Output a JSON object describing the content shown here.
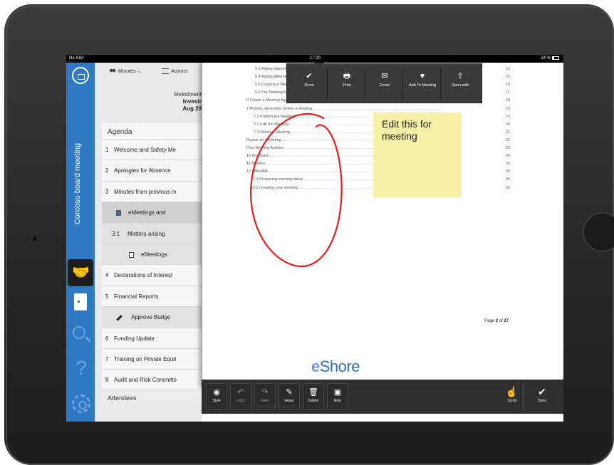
{
  "status_bar": {
    "carrier": "No SIM",
    "time": "17:20",
    "battery": "24 %"
  },
  "rail": {
    "title": "Contoso board meeting"
  },
  "panel": {
    "toolbar": {
      "minutes": "Minutes",
      "actions": "Actions"
    },
    "header": {
      "line1": "Investment",
      "line2": "Investr",
      "line3": "Aug 20"
    },
    "agenda_title": "Agenda",
    "agenda": [
      {
        "num": "1",
        "label": "Welcome and Safety Me"
      },
      {
        "num": "2",
        "label": "Apologies for Absence"
      },
      {
        "num": "3",
        "label": "Minutes from previous m"
      },
      {
        "num": "",
        "label": "eMeetings and"
      },
      {
        "num": "3.1",
        "label": "Matters arising"
      },
      {
        "num": "",
        "label": "eMeetings"
      },
      {
        "num": "4",
        "label": "Declarations of Interest"
      },
      {
        "num": "5",
        "label": "Financial Reports"
      },
      {
        "num": "",
        "label": "Approve Budge"
      },
      {
        "num": "6",
        "label": "Funding Update"
      },
      {
        "num": "7",
        "label": "Training on Private Equit"
      },
      {
        "num": "8",
        "label": "Audit and Risk Committe"
      }
    ],
    "attendees": "Attendees"
  },
  "document": {
    "toc": [
      {
        "text": "5.3  Adding Agenda Items",
        "page": "13"
      },
      {
        "text": "5.4  Adding Attendees",
        "page": "15"
      },
      {
        "text": "5.5  Copying a Meeting",
        "page": "16"
      },
      {
        "text": "5.6  Pre Meeting Actions",
        "page": "17"
      },
      {
        "text": "6  Create a Meeting Agenda",
        "page": "18"
      },
      {
        "text": "7  Publish, Amend/or Delete a Meeting",
        "page": "19"
      },
      {
        "text": "7.1  Publish the Meeting",
        "page": "19"
      },
      {
        "text": "7.2  Edit the Meeting",
        "page": "20"
      },
      {
        "text": "7.3  Delete a Meeting",
        "page": "21"
      },
      {
        "text": "Revive an eMeeting",
        "page": "22"
      },
      {
        "text": "Post Meeting Actions",
        "page": "23"
      },
      {
        "text": "10  Feedback",
        "page": "24"
      },
      {
        "text": "11  Minutes",
        "page": "24"
      },
      {
        "text": "12  eMeetMe",
        "page": "25"
      },
      {
        "text": "12.1  Proposing meeting dates",
        "page": "25"
      },
      {
        "text": "12.2  Creating your meeting",
        "page": "26"
      }
    ],
    "footer_prefix": "Page ",
    "footer_current": "2",
    "footer_mid": " of ",
    "footer_total": "27",
    "sticky_note": "Edit this for meeting",
    "logo_e": "e",
    "logo_text": "Shore",
    "ghost_text": "Technical Support"
  },
  "popup": {
    "buttons": [
      {
        "icon": "checkmark-icon",
        "glyph": "✔",
        "label": "Done"
      },
      {
        "icon": "print-icon",
        "glyph": "🖶",
        "label": "Print"
      },
      {
        "icon": "envelope-icon",
        "glyph": "✉",
        "label": "Email"
      },
      {
        "icon": "heart-icon",
        "glyph": "♥",
        "label": "Add To Meeting"
      },
      {
        "icon": "share-icon",
        "glyph": "⇧",
        "label": "Open with"
      }
    ]
  },
  "bottom_bar": {
    "tools": [
      {
        "icon": "style-icon",
        "glyph": "◉",
        "label": "Style"
      },
      {
        "icon": "undo-icon",
        "glyph": "↶",
        "label": "Undo"
      },
      {
        "icon": "redo-icon",
        "glyph": "↷",
        "label": "Redo"
      },
      {
        "icon": "eraser-icon",
        "glyph": "✎",
        "label": "Erase"
      },
      {
        "icon": "trash-icon",
        "glyph": "🗑",
        "label": "Delete"
      },
      {
        "icon": "note-icon",
        "glyph": "▣",
        "label": "Note"
      }
    ],
    "scroll": {
      "icon": "hand-icon",
      "glyph": "☝",
      "label": "Scroll"
    },
    "done": {
      "icon": "checkmark-icon",
      "glyph": "✔",
      "label": "Done"
    }
  }
}
